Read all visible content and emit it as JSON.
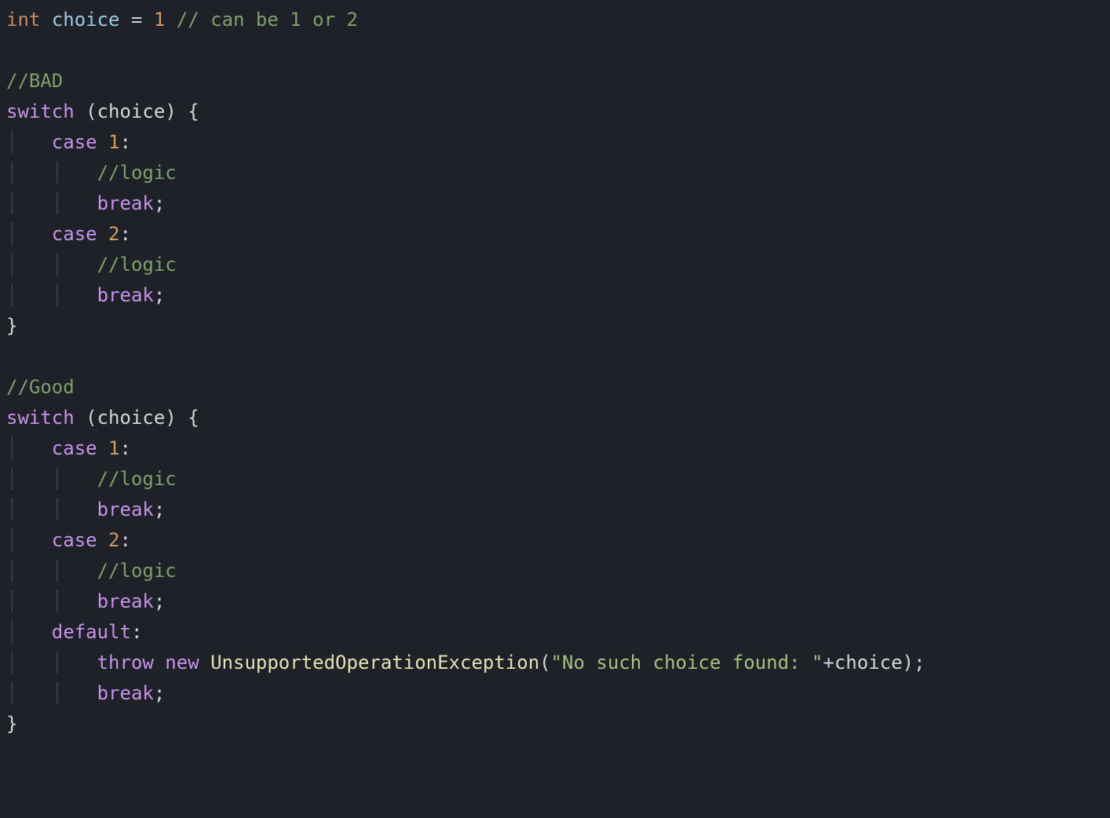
{
  "code": {
    "l01": {
      "t_int": "int",
      "sp1": " ",
      "var": "choice",
      "sp2": " ",
      "eq": "=",
      "sp3": " ",
      "one": "1",
      "sp4": " ",
      "cmt": "// can be 1 or 2"
    },
    "l02": {
      "blank": ""
    },
    "l03": {
      "cmt": "//BAD"
    },
    "l04": {
      "kw": "switch",
      "sp1": " ",
      "lp": "(",
      "var": "choice",
      "rp": ")",
      "sp2": " ",
      "lb": "{"
    },
    "l05": {
      "g1": "│   ",
      "kw": "case",
      "sp1": " ",
      "num": "1",
      "colon": ":"
    },
    "l06": {
      "g1": "│   ",
      "g2": "│   ",
      "cmt": "//logic"
    },
    "l07": {
      "g1": "│   ",
      "g2": "│   ",
      "kw": "break",
      "semi": ";"
    },
    "l08": {
      "g1": "│   ",
      "kw": "case",
      "sp1": " ",
      "num": "2",
      "colon": ":"
    },
    "l09": {
      "g1": "│   ",
      "g2": "│   ",
      "cmt": "//logic"
    },
    "l10": {
      "g1": "│   ",
      "g2": "│   ",
      "kw": "break",
      "semi": ";"
    },
    "l11": {
      "rb": "}"
    },
    "l12": {
      "blank": ""
    },
    "l13": {
      "cmt": "//Good"
    },
    "l14": {
      "kw": "switch",
      "sp1": " ",
      "lp": "(",
      "var": "choice",
      "rp": ")",
      "sp2": " ",
      "lb": "{"
    },
    "l15": {
      "g1": "│   ",
      "kw": "case",
      "sp1": " ",
      "num": "1",
      "colon": ":"
    },
    "l16": {
      "g1": "│   ",
      "g2": "│   ",
      "cmt": "//logic"
    },
    "l17": {
      "g1": "│   ",
      "g2": "│   ",
      "kw": "break",
      "semi": ";"
    },
    "l18": {
      "g1": "│   ",
      "kw": "case",
      "sp1": " ",
      "num": "2",
      "colon": ":"
    },
    "l19": {
      "g1": "│   ",
      "g2": "│   ",
      "cmt": "//logic"
    },
    "l20": {
      "g1": "│   ",
      "g2": "│   ",
      "kw": "break",
      "semi": ";"
    },
    "l21": {
      "g1": "│   ",
      "kw": "default",
      "colon": ":"
    },
    "l22": {
      "g1": "│   ",
      "g2": "│   ",
      "kw1": "throw",
      "sp1": " ",
      "kw2": "new",
      "sp2": " ",
      "cls": "UnsupportedOperationException",
      "lp": "(",
      "str": "\"No such choice found: \"",
      "plus": "+",
      "var": "choice",
      "rp": ")",
      "semi": ";"
    },
    "l23": {
      "g1": "│   ",
      "g2": "│   ",
      "kw": "break",
      "semi": ";"
    },
    "l24": {
      "rb": "}"
    }
  }
}
